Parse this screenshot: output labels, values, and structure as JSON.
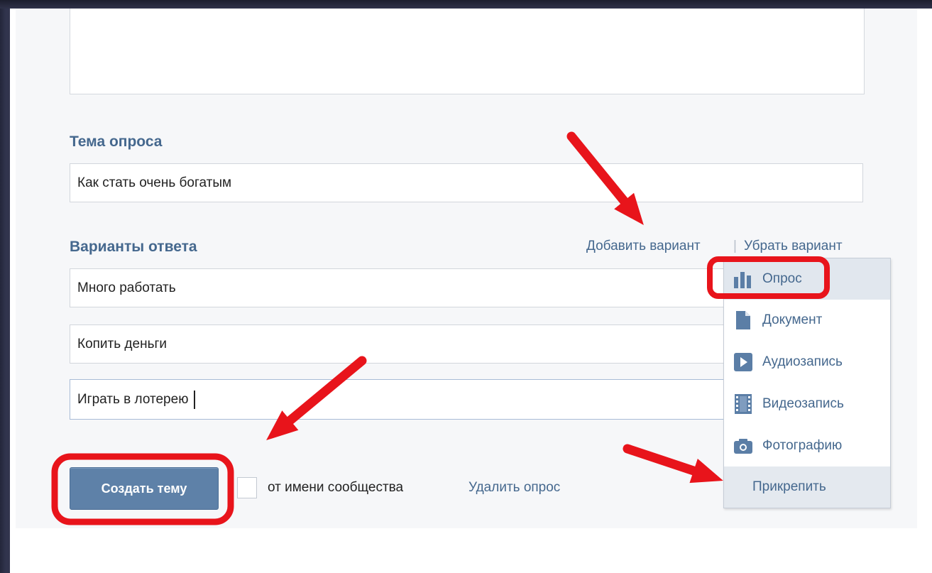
{
  "form": {
    "poll_topic_label": "Тема опроса",
    "poll_topic_value": "Как стать очень богатым",
    "answers_label": "Варианты ответа",
    "add_option_link": "Добавить вариант",
    "separator": "|",
    "remove_option_link": "Убрать вариант",
    "answers": [
      "Много работать",
      "Копить деньги",
      "Играть в лотерею"
    ]
  },
  "footer": {
    "create_button": "Создать тему",
    "on_behalf_label": "от имени сообщества",
    "delete_poll_link": "Удалить опрос"
  },
  "attach_menu": {
    "items": [
      {
        "label": "Опрос",
        "icon": "poll-icon"
      },
      {
        "label": "Документ",
        "icon": "document-icon"
      },
      {
        "label": "Аудиозапись",
        "icon": "audio-icon"
      },
      {
        "label": "Видеозапись",
        "icon": "video-icon"
      },
      {
        "label": "Фотографию",
        "icon": "photo-icon"
      }
    ],
    "attach_label": "Прикрепить"
  },
  "colors": {
    "link": "#45688e",
    "button": "#5e81a8",
    "annotation": "#e8141b"
  }
}
